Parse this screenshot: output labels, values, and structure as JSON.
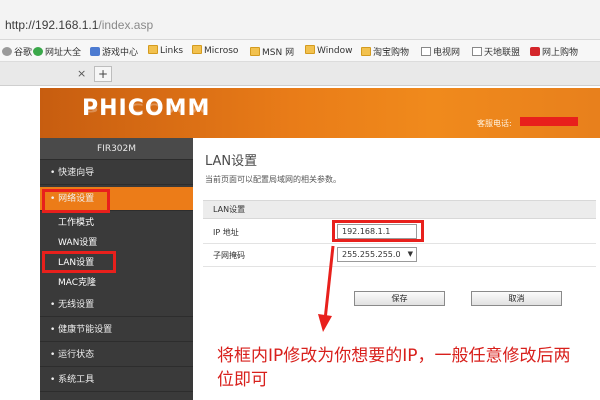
{
  "browser": {
    "url_host": "http://192.168.1.1",
    "url_path": "/index.asp"
  },
  "favorites": [
    {
      "icon": "gray-dot-icon",
      "label": "谷歌"
    },
    {
      "icon": "green-globe-icon",
      "label": "网址大全"
    },
    {
      "icon": "game-icon",
      "label": "游戏中心"
    },
    {
      "icon": "folder-icon",
      "label": "Links"
    },
    {
      "icon": "folder-icon",
      "label": "Microso"
    },
    {
      "icon": "folder-icon",
      "label": "MSN 网"
    },
    {
      "icon": "folder-icon",
      "label": "Window"
    },
    {
      "icon": "folder-icon",
      "label": "淘宝购物"
    },
    {
      "icon": "page-icon",
      "label": "电视网"
    },
    {
      "icon": "page-icon",
      "label": "天地联盟"
    },
    {
      "icon": "red-square-icon",
      "label": "网上购物"
    }
  ],
  "tabs": {
    "close": "×",
    "new": "+"
  },
  "router": {
    "brand": "PHICOMM",
    "hotline_label": "客服电话:",
    "model": "FIR302M"
  },
  "sidebar": {
    "items": [
      {
        "label": "• 快速向导"
      },
      {
        "label": "• 网络设置"
      },
      {
        "label": "• 无线设置"
      },
      {
        "label": "• 健康节能设置"
      },
      {
        "label": "• 运行状态"
      },
      {
        "label": "• 系统工具"
      }
    ],
    "subitems": [
      {
        "label": "工作模式"
      },
      {
        "label": "WAN设置"
      },
      {
        "label": "LAN设置"
      },
      {
        "label": "MAC克隆"
      }
    ]
  },
  "main": {
    "title": "LAN设置",
    "description": "当前页面可以配置局域网的相关参数。",
    "section_title": "LAN设置",
    "ip_label": "IP 地址",
    "ip_value": "192.168.1.1",
    "mask_label": "子网掩码",
    "mask_value": "255.255.255.0",
    "save_label": "保存",
    "cancel_label": "取消"
  },
  "annotation": {
    "text": "将框内IP修改为你想要的IP，一般任意修改后两位即可"
  },
  "colors": {
    "accent_orange": "#ec7c18",
    "highlight_red": "#e8201c",
    "sidebar_dark": "#3a3a3a"
  }
}
